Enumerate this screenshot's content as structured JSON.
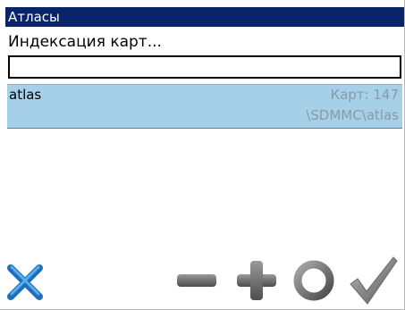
{
  "window": {
    "title": "Атласы"
  },
  "status": {
    "text": "Индексация карт...",
    "progress_fraction": 0
  },
  "atlas_list": {
    "items": [
      {
        "name": "atlas",
        "count_text": "Карт: 147",
        "path": "\\SDMMC\\atlas",
        "selected": true
      }
    ]
  },
  "toolbar": {
    "buttons": [
      {
        "icon": "close-icon",
        "color": "#2a86d4"
      },
      {
        "icon": "minus-icon",
        "color": "#6a6a6a"
      },
      {
        "icon": "plus-icon",
        "color": "#6a6a6a"
      },
      {
        "icon": "refresh-icon",
        "color": "#6a6a6a"
      },
      {
        "icon": "checkmark-icon",
        "color": "#7a7a7a"
      }
    ]
  },
  "colors": {
    "titlebar_bg": "#0a246a",
    "selection_bg": "#a6cfe8",
    "secondary_text": "#8a9aa6"
  }
}
